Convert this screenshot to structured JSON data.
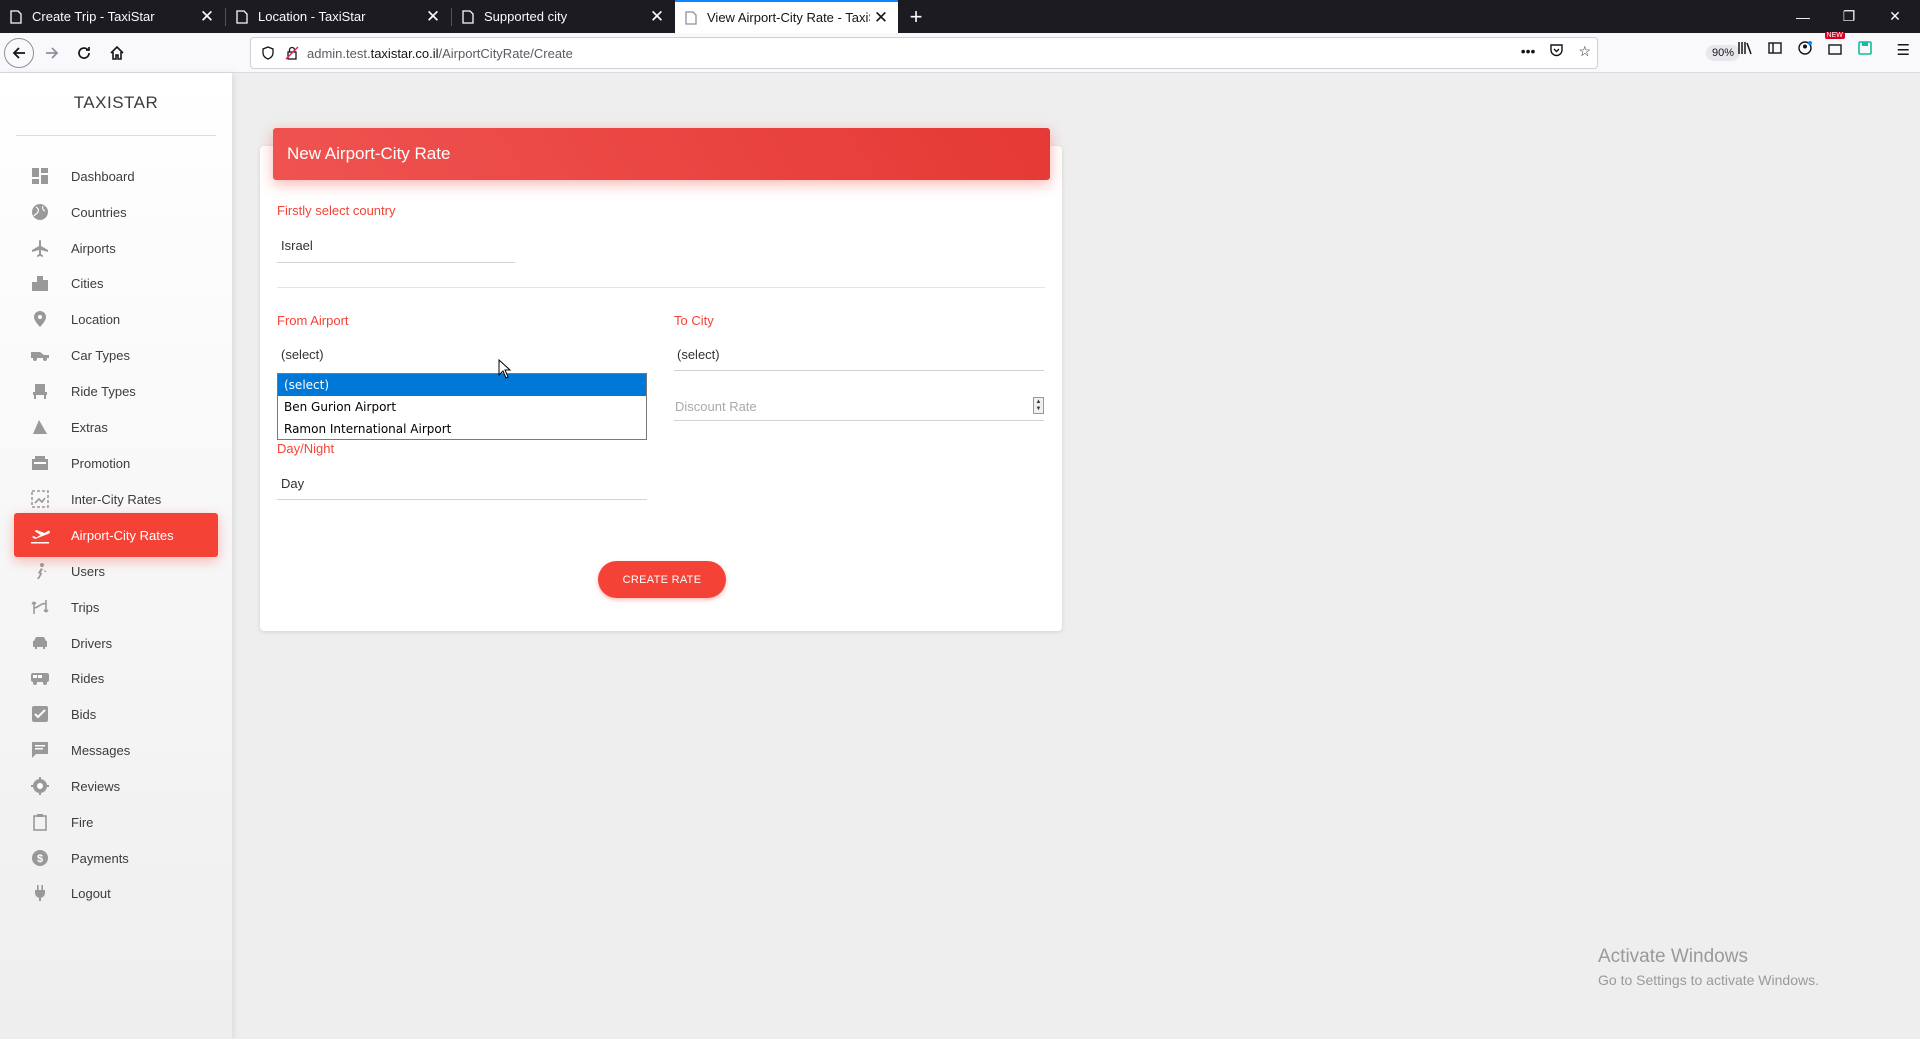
{
  "browser": {
    "tabs": [
      {
        "title": "Create Trip - TaxiStar",
        "active": false
      },
      {
        "title": "Location - TaxiStar",
        "active": false
      },
      {
        "title": "Supported city",
        "active": false
      },
      {
        "title": "View Airport-City Rate - TaxiSta",
        "active": true
      }
    ],
    "url_prefix": "admin.test.",
    "url_domain": "taxistar.co.il",
    "url_path": "/AirportCityRate/Create",
    "zoom": "90%",
    "notification_badge": "NEW"
  },
  "sidebar": {
    "brand": "TAXISTAR",
    "items": [
      {
        "label": "Dashboard",
        "icon": "dashboard-icon"
      },
      {
        "label": "Countries",
        "icon": "globe-icon"
      },
      {
        "label": "Airports",
        "icon": "airplane-icon"
      },
      {
        "label": "Cities",
        "icon": "city-icon"
      },
      {
        "label": "Location",
        "icon": "location-pin-icon"
      },
      {
        "label": "Car Types",
        "icon": "car-type-icon"
      },
      {
        "label": "Ride Types",
        "icon": "seat-icon"
      },
      {
        "label": "Extras",
        "icon": "extras-icon"
      },
      {
        "label": "Promotion",
        "icon": "promotion-icon"
      },
      {
        "label": "Inter-City Rates",
        "icon": "inter-city-icon"
      },
      {
        "label": "Airport-City Rates",
        "icon": "flight-takeoff-icon",
        "active": true
      },
      {
        "label": "Users",
        "icon": "users-icon"
      },
      {
        "label": "Trips",
        "icon": "trips-icon"
      },
      {
        "label": "Drivers",
        "icon": "driver-car-icon"
      },
      {
        "label": "Rides",
        "icon": "bus-icon"
      },
      {
        "label": "Bids",
        "icon": "checkbox-icon"
      },
      {
        "label": "Messages",
        "icon": "message-icon"
      },
      {
        "label": "Reviews",
        "icon": "reviews-icon"
      },
      {
        "label": "Fire",
        "icon": "clipboard-icon"
      },
      {
        "label": "Payments",
        "icon": "dollar-icon"
      },
      {
        "label": "Logout",
        "icon": "power-plug-icon"
      }
    ]
  },
  "form": {
    "title": "New Airport-City Rate",
    "country_label": "Firstly select country",
    "country_value": "Israel",
    "from_airport_label": "From Airport",
    "from_airport_value": "(select)",
    "to_city_label": "To City",
    "to_city_value": "(select)",
    "discount_rate_placeholder": "Discount Rate",
    "day_night_label": "Day/Night",
    "day_night_value": "Day",
    "airport_options": [
      "(select)",
      "Ben Gurion Airport",
      "Ramon International Airport"
    ],
    "submit_label": "CREATE RATE"
  },
  "watermark": {
    "line1": "Activate Windows",
    "line2": "Go to Settings to activate Windows."
  },
  "colors": {
    "accent": "#f44336",
    "tabbar": "#1c1b22",
    "selection": "#0078d7"
  }
}
